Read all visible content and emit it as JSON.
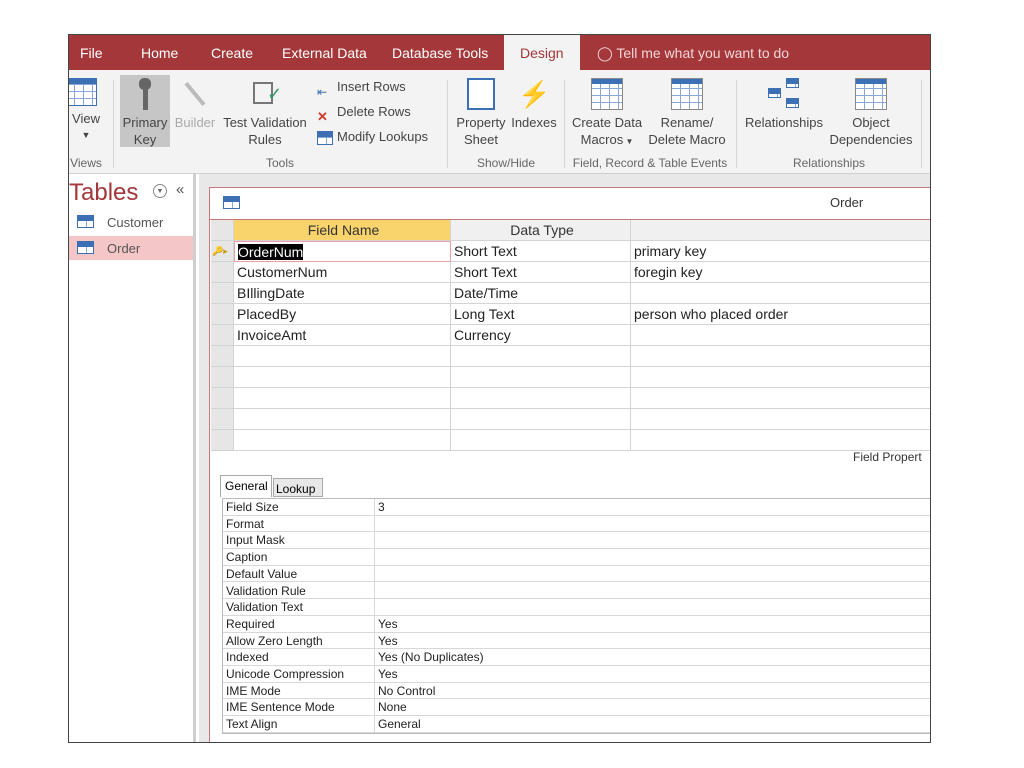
{
  "ribbon": {
    "tabs": [
      "File",
      "Home",
      "Create",
      "External Data",
      "Database Tools",
      "Design"
    ],
    "active_tab": "Design",
    "tell_me": "Tell me what you want to do",
    "views": {
      "view": "View",
      "group": "Views"
    },
    "tools": {
      "primary_key": [
        "Primary",
        "Key"
      ],
      "builder": "Builder",
      "test_validation": [
        "Test Validation",
        "Rules"
      ],
      "insert_rows": "Insert Rows",
      "delete_rows": "Delete Rows",
      "modify_lookups": "Modify Lookups",
      "group": "Tools"
    },
    "show_hide": {
      "property_sheet": [
        "Property",
        "Sheet"
      ],
      "indexes": "Indexes",
      "group": "Show/Hide"
    },
    "events": {
      "create_data_macros": [
        "Create Data",
        "Macros"
      ],
      "rename_delete_macro": [
        "Rename/",
        "Delete Macro"
      ],
      "group": "Field, Record & Table Events"
    },
    "relationships": {
      "relationships": "Relationships",
      "object_dependencies": [
        "Object",
        "Dependencies"
      ],
      "group": "Relationships"
    },
    "accent": "#a4373a"
  },
  "nav": {
    "title": "Tables",
    "items": [
      {
        "label": "Customer",
        "selected": false
      },
      {
        "label": "Order",
        "selected": true
      }
    ]
  },
  "document": {
    "tab_title": "Order",
    "columns": [
      "Field Name",
      "Data Type",
      ""
    ],
    "rows": [
      {
        "field": "OrderNum",
        "type": "Short Text",
        "description": "primary key",
        "primary_key": true
      },
      {
        "field": "CustomerNum",
        "type": "Short Text",
        "description": "foregin key"
      },
      {
        "field": "BIllingDate",
        "type": "Date/Time",
        "description": ""
      },
      {
        "field": "PlacedBy",
        "type": "Long Text",
        "description": "person who placed order"
      },
      {
        "field": "InvoiceAmt",
        "type": "Currency",
        "description": ""
      }
    ],
    "field_properties_label": "Field Propert",
    "prop_tabs": [
      "General",
      "Lookup"
    ],
    "properties": [
      {
        "name": "Field Size",
        "value": "3"
      },
      {
        "name": "Format",
        "value": ""
      },
      {
        "name": "Input Mask",
        "value": ""
      },
      {
        "name": "Caption",
        "value": ""
      },
      {
        "name": "Default Value",
        "value": ""
      },
      {
        "name": "Validation Rule",
        "value": ""
      },
      {
        "name": "Validation Text",
        "value": ""
      },
      {
        "name": "Required",
        "value": "Yes"
      },
      {
        "name": "Allow Zero Length",
        "value": "Yes"
      },
      {
        "name": "Indexed",
        "value": "Yes (No Duplicates)"
      },
      {
        "name": "Unicode Compression",
        "value": "Yes"
      },
      {
        "name": "IME Mode",
        "value": "No Control"
      },
      {
        "name": "IME Sentence Mode",
        "value": "None"
      },
      {
        "name": "Text Align",
        "value": "General"
      }
    ]
  }
}
